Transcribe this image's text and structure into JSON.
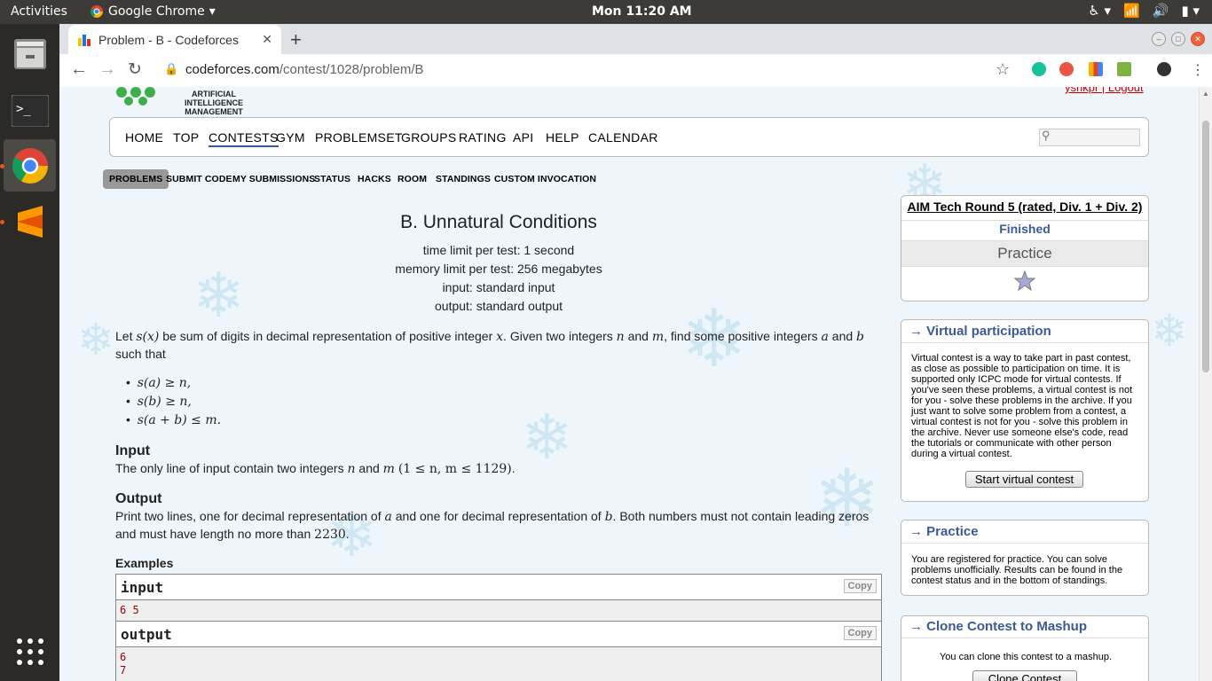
{
  "os": {
    "activities": "Activities",
    "app_name": "Google Chrome",
    "clock": "Mon 11:20 AM"
  },
  "browser": {
    "tab_title": "Problem - B - Codeforces",
    "url_host": "codeforces.com",
    "url_path": "/contest/1028/problem/B"
  },
  "site": {
    "logo_text": "ARTIFICIAL INTELLIGENCE MANAGEMENT",
    "user_link": "ysnkpr | Logout",
    "menu": [
      "HOME",
      "TOP",
      "CONTESTS",
      "GYM",
      "PROBLEMSET",
      "GROUPS",
      "RATING",
      "API",
      "HELP",
      "CALENDAR"
    ],
    "active_menu": "CONTESTS",
    "submenu": [
      "PROBLEMS",
      "SUBMIT CODE",
      "MY SUBMISSIONS",
      "STATUS",
      "HACKS",
      "ROOM",
      "STANDINGS",
      "CUSTOM INVOCATION"
    ],
    "active_submenu": "PROBLEMS"
  },
  "problem": {
    "title": "B. Unnatural Conditions",
    "time_limit": "time limit per test: 1 second",
    "memory_limit": "memory limit per test: 256 megabytes",
    "input": "input: standard input",
    "output": "output: standard output",
    "statement_1": "Let",
    "statement_sx": "s(x)",
    "statement_2": "be sum of digits in decimal representation of positive integer",
    "statement_x": "x",
    "statement_3": ". Given two integers",
    "statement_n": "n",
    "statement_and": "and",
    "statement_m": "m",
    "statement_4": ", find some positive integers",
    "statement_a": "a",
    "statement_and2": "and",
    "statement_b": "b",
    "statement_5": "such that",
    "conditions": [
      "s(a) ≥ n,",
      "s(b) ≥ n,",
      "s(a + b) ≤ m."
    ],
    "input_title": "Input",
    "input_text_1": "The only line of input contain two integers",
    "input_n": "n",
    "input_and": "and",
    "input_m": "m",
    "input_constraint": "(1 ≤ n, m ≤ 1129)",
    "input_end": ".",
    "output_title": "Output",
    "output_text_1": "Print two lines, one for decimal representation of",
    "output_a": "a",
    "output_text_2": "and one for decimal representation of",
    "output_b": "b",
    "output_text_3": ". Both numbers must not contain leading zeros",
    "output_text_4": "and must have length no more than",
    "output_len": "2230",
    "output_end": ".",
    "examples_title": "Examples",
    "sample_input_label": "input",
    "sample_input": "6 5",
    "sample_output_label": "output",
    "sample_output_1": "6",
    "sample_output_2": "7",
    "copy_label": "Copy"
  },
  "sidebar": {
    "contest_name": "AIM Tech Round 5 (rated, Div. 1 + Div. 2)",
    "contest_status": "Finished",
    "contest_phase": "Practice",
    "virtual_title": "→ Virtual participation",
    "virtual_text": "Virtual contest is a way to take part in past contest, as close as possible to participation on time. It is supported only ICPC mode for virtual contests. If you've seen these problems, a virtual contest is not for you - solve these problems in the archive. If you just want to solve some problem from a contest, a virtual contest is not for you - solve this problem in the archive. Never use someone else's code, read the tutorials or communicate with other person during a virtual contest.",
    "virtual_button": "Start virtual contest",
    "practice_title": "→ Practice",
    "practice_text": "You are registered for practice. You can solve problems unofficially. Results can be found in the contest status and in the bottom of standings.",
    "clone_title": "→ Clone Contest to Mashup",
    "clone_text": "You can clone this contest to a mashup.",
    "clone_button": "Clone Contest"
  },
  "colors": {
    "accent": "#3b5998",
    "sample_text": "#990000",
    "ubuntu_orange": "#e95420"
  }
}
